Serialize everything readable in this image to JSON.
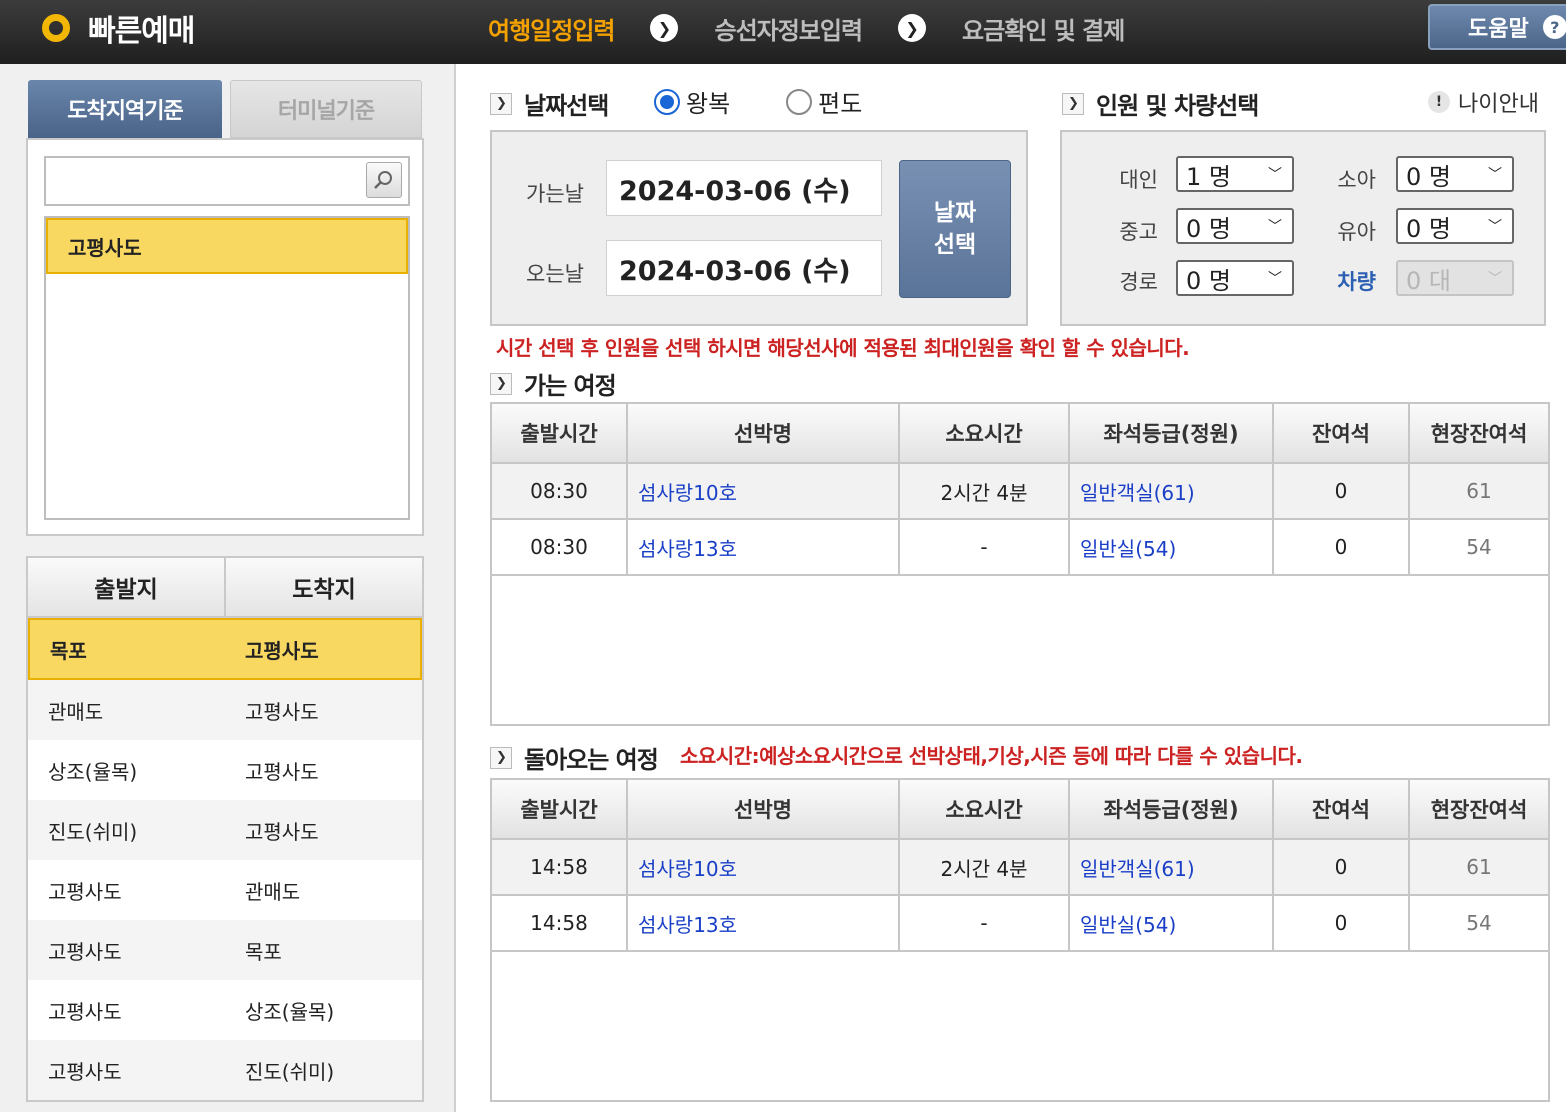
{
  "header": {
    "logo_text": "빠른예매",
    "steps": [
      "여행일정입력",
      "승선자정보입력",
      "요금확인 및 결제"
    ],
    "help_label": "도움말"
  },
  "left": {
    "tabs": [
      "도착지역기준",
      "터미널기준"
    ],
    "search": {
      "value": "",
      "placeholder": ""
    },
    "selected_region": "고평사도",
    "route_headers": [
      "출발지",
      "도착지"
    ],
    "routes": [
      {
        "from": "목포",
        "to": "고평사도",
        "selected": true
      },
      {
        "from": "관매도",
        "to": "고평사도"
      },
      {
        "from": "상조(율목)",
        "to": "고평사도"
      },
      {
        "from": "진도(쉬미)",
        "to": "고평사도"
      },
      {
        "from": "고평사도",
        "to": "관매도"
      },
      {
        "from": "고평사도",
        "to": "목포"
      },
      {
        "from": "고평사도",
        "to": "상조(율목)"
      },
      {
        "from": "고평사도",
        "to": "진도(쉬미)"
      }
    ]
  },
  "date_section": {
    "title": "날짜선택",
    "round_trip": "왕복",
    "one_way": "편도",
    "depart_label": "가는날",
    "depart_value": "2024-03-06 (수)",
    "return_label": "오는날",
    "return_value": "2024-03-06 (수)",
    "select_button": "날짜\n선택"
  },
  "pax_section": {
    "title": "인원 및 차량선택",
    "age_guide": "나이안내",
    "fields": [
      {
        "label": "대인",
        "value": "1 명"
      },
      {
        "label": "소아",
        "value": "0 명"
      },
      {
        "label": "중고",
        "value": "0 명"
      },
      {
        "label": "유아",
        "value": "0 명"
      },
      {
        "label": "경로",
        "value": "0 명"
      },
      {
        "label": "차량",
        "value": "0 대"
      }
    ]
  },
  "notice_pax": "시간 선택 후 인원을 선택 하시면 해당선사에 적용된 최대인원을 확인 할 수 있습니다.",
  "outbound": {
    "title": "가는 여정",
    "headers": [
      "출발시간",
      "선박명",
      "소요시간",
      "좌석등급(정원)",
      "잔여석",
      "현장잔여석"
    ],
    "rows": [
      [
        "08:30",
        "섬사랑10호",
        "2시간 4분",
        "일반객실(61)",
        "0",
        "61"
      ],
      [
        "08:30",
        "섬사랑13호",
        "-",
        "일반실(54)",
        "0",
        "54"
      ]
    ]
  },
  "inbound": {
    "title": "돌아오는 여정",
    "notice": "소요시간:예상소요시간으로 선박상태,기상,시즌 등에 따라 다를 수 있습니다.",
    "headers": [
      "출발시간",
      "선박명",
      "소요시간",
      "좌석등급(정원)",
      "잔여석",
      "현장잔여석"
    ],
    "rows": [
      [
        "14:58",
        "섬사랑10호",
        "2시간 4분",
        "일반객실(61)",
        "0",
        "61"
      ],
      [
        "14:58",
        "섬사랑13호",
        "-",
        "일반실(54)",
        "0",
        "54"
      ]
    ]
  },
  "colors": {
    "accent": "#f2a100",
    "selected": "#f9d862",
    "link": "#1a3fc7",
    "notice": "#cc2222",
    "button": "#5a7398"
  }
}
